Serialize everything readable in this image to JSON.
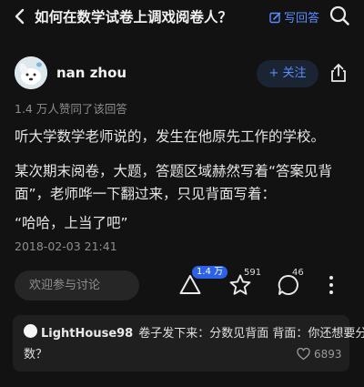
{
  "header": {
    "question_title": "如何在数学试卷上调戏阅卷人？",
    "write_answer_label": "写回答",
    "colors": {
      "accent": "#5a8dff",
      "background": "#121212"
    }
  },
  "answer": {
    "author_name": "nan zhou",
    "follow_label": "+ 关注",
    "upvote_summary": "1.4 万人赞同了该回答",
    "paragraphs": [
      "听大学数学老师说的，发生在他原先工作的学校。",
      "某次期末阅卷，大题，答题区域赫然写着“答案见背",
      "面”，老师哗一下翻过来，只见背面写着：",
      "“哈哈，上当了吧”"
    ],
    "date": "2018-02-03 21:41"
  },
  "actions": {
    "discuss_placeholder": "欢迎参与讨论",
    "upvote_count": "1.4 万",
    "favorite_count": "591",
    "comment_count": "46"
  },
  "top_comment": {
    "user": "LightHouse98",
    "text_line1": "卷子发下来：分数见背面 背面：你还想要分",
    "text_line2": "数？",
    "likes": "6893"
  }
}
